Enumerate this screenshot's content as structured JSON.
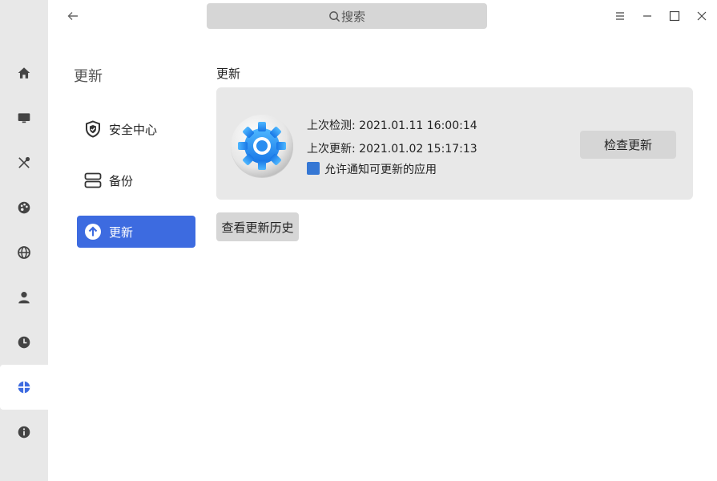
{
  "rail": {
    "items": [
      {
        "icon": "home-icon"
      },
      {
        "icon": "display-icon"
      },
      {
        "icon": "tools-icon"
      },
      {
        "icon": "palette-icon"
      },
      {
        "icon": "network-icon"
      },
      {
        "icon": "account-icon"
      },
      {
        "icon": "clock-icon"
      },
      {
        "icon": "update-icon",
        "active": true
      },
      {
        "icon": "info-icon"
      }
    ],
    "active_color": "#3d6be0"
  },
  "titlebar": {
    "search_placeholder": "搜索"
  },
  "nav": {
    "title": "更新",
    "items": [
      {
        "label": "安全中心",
        "icon": "shield-icon"
      },
      {
        "label": "备份",
        "icon": "backup-icon"
      },
      {
        "label": "更新",
        "icon": "arrow-up-circle-icon",
        "active": true
      }
    ]
  },
  "main": {
    "section_title": "更新",
    "last_check": "上次检测: 2021.01.11 16:00:14",
    "last_update": "上次更新: 2021.01.02 15:17:13",
    "allow_notify_label": "允许通知可更新的应用",
    "allow_notify_checked": true,
    "check_update_button": "检查更新",
    "history_button": "查看更新历史"
  }
}
